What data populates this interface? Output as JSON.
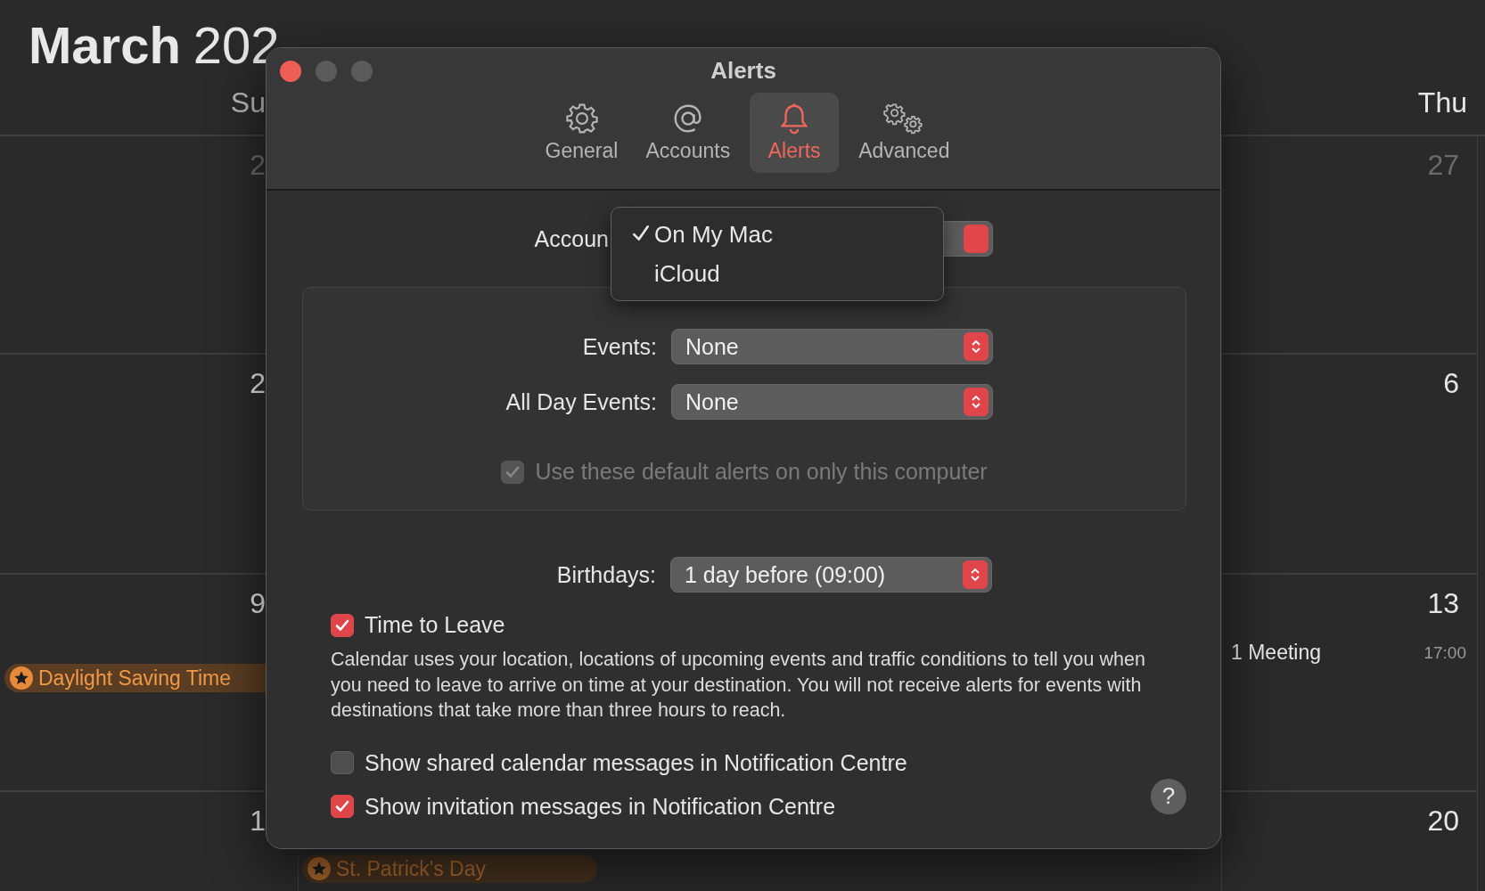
{
  "calendar": {
    "month": "March",
    "year": "202",
    "left_weekday": "Su",
    "right_weekday": "Thu",
    "left_days": [
      {
        "date": "2",
        "in_month": false
      },
      {
        "date": "2",
        "in_month": true
      },
      {
        "date": "9",
        "in_month": true,
        "event": {
          "title": "Daylight Saving Time"
        }
      },
      {
        "date": "1",
        "in_month": true
      }
    ],
    "right_days": [
      {
        "date": "27",
        "in_month": false
      },
      {
        "date": "6",
        "in_month": true
      },
      {
        "date": "13",
        "in_month": true,
        "event": {
          "title": "1 Meeting",
          "time": "17:00"
        }
      },
      {
        "date": "20",
        "in_month": true
      }
    ],
    "bottom_event": {
      "title": "St. Patrick's Day"
    }
  },
  "window": {
    "title": "Alerts",
    "tabs": [
      {
        "label": "General",
        "selected": false
      },
      {
        "label": "Accounts",
        "selected": false
      },
      {
        "label": "Alerts",
        "selected": true
      },
      {
        "label": "Advanced",
        "selected": false
      }
    ],
    "account": {
      "label": "Accoun",
      "menu": [
        {
          "label": "On My Mac",
          "selected": true
        },
        {
          "label": "iCloud",
          "selected": false
        }
      ]
    },
    "defaults": [
      {
        "label": "Events:",
        "value": "None"
      },
      {
        "label": "All Day Events:",
        "value": "None"
      }
    ],
    "default_alerts": {
      "label": "Use these default alerts on only this computer",
      "checked": true,
      "disabled": true
    },
    "birthdays": {
      "label": "Birthdays:",
      "value": "1 day before (09:00)"
    },
    "time_to_leave": {
      "label": "Time to Leave",
      "checked": true
    },
    "description": "Calendar uses your location, locations of upcoming events and traffic conditions to tell you when you need to leave to arrive on time at your destination. You will not receive alerts for events with destinations that take more than three hours to reach.",
    "notifications": [
      {
        "label": "Show shared calendar messages in Notification Centre",
        "checked": false
      },
      {
        "label": "Show invitation messages in Notification Centre",
        "checked": true
      }
    ],
    "help": "?"
  }
}
